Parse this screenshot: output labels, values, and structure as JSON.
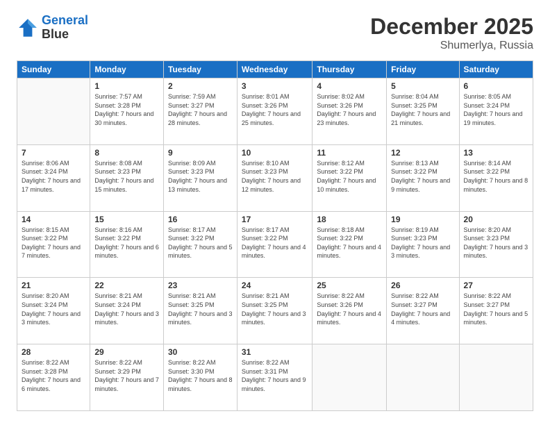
{
  "header": {
    "logo_line1": "General",
    "logo_line2": "Blue",
    "month": "December 2025",
    "location": "Shumerlya, Russia"
  },
  "weekdays": [
    "Sunday",
    "Monday",
    "Tuesday",
    "Wednesday",
    "Thursday",
    "Friday",
    "Saturday"
  ],
  "weeks": [
    [
      {
        "day": "",
        "sunrise": "",
        "sunset": "",
        "daylight": ""
      },
      {
        "day": "1",
        "sunrise": "Sunrise: 7:57 AM",
        "sunset": "Sunset: 3:28 PM",
        "daylight": "Daylight: 7 hours and 30 minutes."
      },
      {
        "day": "2",
        "sunrise": "Sunrise: 7:59 AM",
        "sunset": "Sunset: 3:27 PM",
        "daylight": "Daylight: 7 hours and 28 minutes."
      },
      {
        "day": "3",
        "sunrise": "Sunrise: 8:01 AM",
        "sunset": "Sunset: 3:26 PM",
        "daylight": "Daylight: 7 hours and 25 minutes."
      },
      {
        "day": "4",
        "sunrise": "Sunrise: 8:02 AM",
        "sunset": "Sunset: 3:26 PM",
        "daylight": "Daylight: 7 hours and 23 minutes."
      },
      {
        "day": "5",
        "sunrise": "Sunrise: 8:04 AM",
        "sunset": "Sunset: 3:25 PM",
        "daylight": "Daylight: 7 hours and 21 minutes."
      },
      {
        "day": "6",
        "sunrise": "Sunrise: 8:05 AM",
        "sunset": "Sunset: 3:24 PM",
        "daylight": "Daylight: 7 hours and 19 minutes."
      }
    ],
    [
      {
        "day": "7",
        "sunrise": "Sunrise: 8:06 AM",
        "sunset": "Sunset: 3:24 PM",
        "daylight": "Daylight: 7 hours and 17 minutes."
      },
      {
        "day": "8",
        "sunrise": "Sunrise: 8:08 AM",
        "sunset": "Sunset: 3:23 PM",
        "daylight": "Daylight: 7 hours and 15 minutes."
      },
      {
        "day": "9",
        "sunrise": "Sunrise: 8:09 AM",
        "sunset": "Sunset: 3:23 PM",
        "daylight": "Daylight: 7 hours and 13 minutes."
      },
      {
        "day": "10",
        "sunrise": "Sunrise: 8:10 AM",
        "sunset": "Sunset: 3:23 PM",
        "daylight": "Daylight: 7 hours and 12 minutes."
      },
      {
        "day": "11",
        "sunrise": "Sunrise: 8:12 AM",
        "sunset": "Sunset: 3:22 PM",
        "daylight": "Daylight: 7 hours and 10 minutes."
      },
      {
        "day": "12",
        "sunrise": "Sunrise: 8:13 AM",
        "sunset": "Sunset: 3:22 PM",
        "daylight": "Daylight: 7 hours and 9 minutes."
      },
      {
        "day": "13",
        "sunrise": "Sunrise: 8:14 AM",
        "sunset": "Sunset: 3:22 PM",
        "daylight": "Daylight: 7 hours and 8 minutes."
      }
    ],
    [
      {
        "day": "14",
        "sunrise": "Sunrise: 8:15 AM",
        "sunset": "Sunset: 3:22 PM",
        "daylight": "Daylight: 7 hours and 7 minutes."
      },
      {
        "day": "15",
        "sunrise": "Sunrise: 8:16 AM",
        "sunset": "Sunset: 3:22 PM",
        "daylight": "Daylight: 7 hours and 6 minutes."
      },
      {
        "day": "16",
        "sunrise": "Sunrise: 8:17 AM",
        "sunset": "Sunset: 3:22 PM",
        "daylight": "Daylight: 7 hours and 5 minutes."
      },
      {
        "day": "17",
        "sunrise": "Sunrise: 8:17 AM",
        "sunset": "Sunset: 3:22 PM",
        "daylight": "Daylight: 7 hours and 4 minutes."
      },
      {
        "day": "18",
        "sunrise": "Sunrise: 8:18 AM",
        "sunset": "Sunset: 3:22 PM",
        "daylight": "Daylight: 7 hours and 4 minutes."
      },
      {
        "day": "19",
        "sunrise": "Sunrise: 8:19 AM",
        "sunset": "Sunset: 3:23 PM",
        "daylight": "Daylight: 7 hours and 3 minutes."
      },
      {
        "day": "20",
        "sunrise": "Sunrise: 8:20 AM",
        "sunset": "Sunset: 3:23 PM",
        "daylight": "Daylight: 7 hours and 3 minutes."
      }
    ],
    [
      {
        "day": "21",
        "sunrise": "Sunrise: 8:20 AM",
        "sunset": "Sunset: 3:24 PM",
        "daylight": "Daylight: 7 hours and 3 minutes."
      },
      {
        "day": "22",
        "sunrise": "Sunrise: 8:21 AM",
        "sunset": "Sunset: 3:24 PM",
        "daylight": "Daylight: 7 hours and 3 minutes."
      },
      {
        "day": "23",
        "sunrise": "Sunrise: 8:21 AM",
        "sunset": "Sunset: 3:25 PM",
        "daylight": "Daylight: 7 hours and 3 minutes."
      },
      {
        "day": "24",
        "sunrise": "Sunrise: 8:21 AM",
        "sunset": "Sunset: 3:25 PM",
        "daylight": "Daylight: 7 hours and 3 minutes."
      },
      {
        "day": "25",
        "sunrise": "Sunrise: 8:22 AM",
        "sunset": "Sunset: 3:26 PM",
        "daylight": "Daylight: 7 hours and 4 minutes."
      },
      {
        "day": "26",
        "sunrise": "Sunrise: 8:22 AM",
        "sunset": "Sunset: 3:27 PM",
        "daylight": "Daylight: 7 hours and 4 minutes."
      },
      {
        "day": "27",
        "sunrise": "Sunrise: 8:22 AM",
        "sunset": "Sunset: 3:27 PM",
        "daylight": "Daylight: 7 hours and 5 minutes."
      }
    ],
    [
      {
        "day": "28",
        "sunrise": "Sunrise: 8:22 AM",
        "sunset": "Sunset: 3:28 PM",
        "daylight": "Daylight: 7 hours and 6 minutes."
      },
      {
        "day": "29",
        "sunrise": "Sunrise: 8:22 AM",
        "sunset": "Sunset: 3:29 PM",
        "daylight": "Daylight: 7 hours and 7 minutes."
      },
      {
        "day": "30",
        "sunrise": "Sunrise: 8:22 AM",
        "sunset": "Sunset: 3:30 PM",
        "daylight": "Daylight: 7 hours and 8 minutes."
      },
      {
        "day": "31",
        "sunrise": "Sunrise: 8:22 AM",
        "sunset": "Sunset: 3:31 PM",
        "daylight": "Daylight: 7 hours and 9 minutes."
      },
      {
        "day": "",
        "sunrise": "",
        "sunset": "",
        "daylight": ""
      },
      {
        "day": "",
        "sunrise": "",
        "sunset": "",
        "daylight": ""
      },
      {
        "day": "",
        "sunrise": "",
        "sunset": "",
        "daylight": ""
      }
    ]
  ]
}
